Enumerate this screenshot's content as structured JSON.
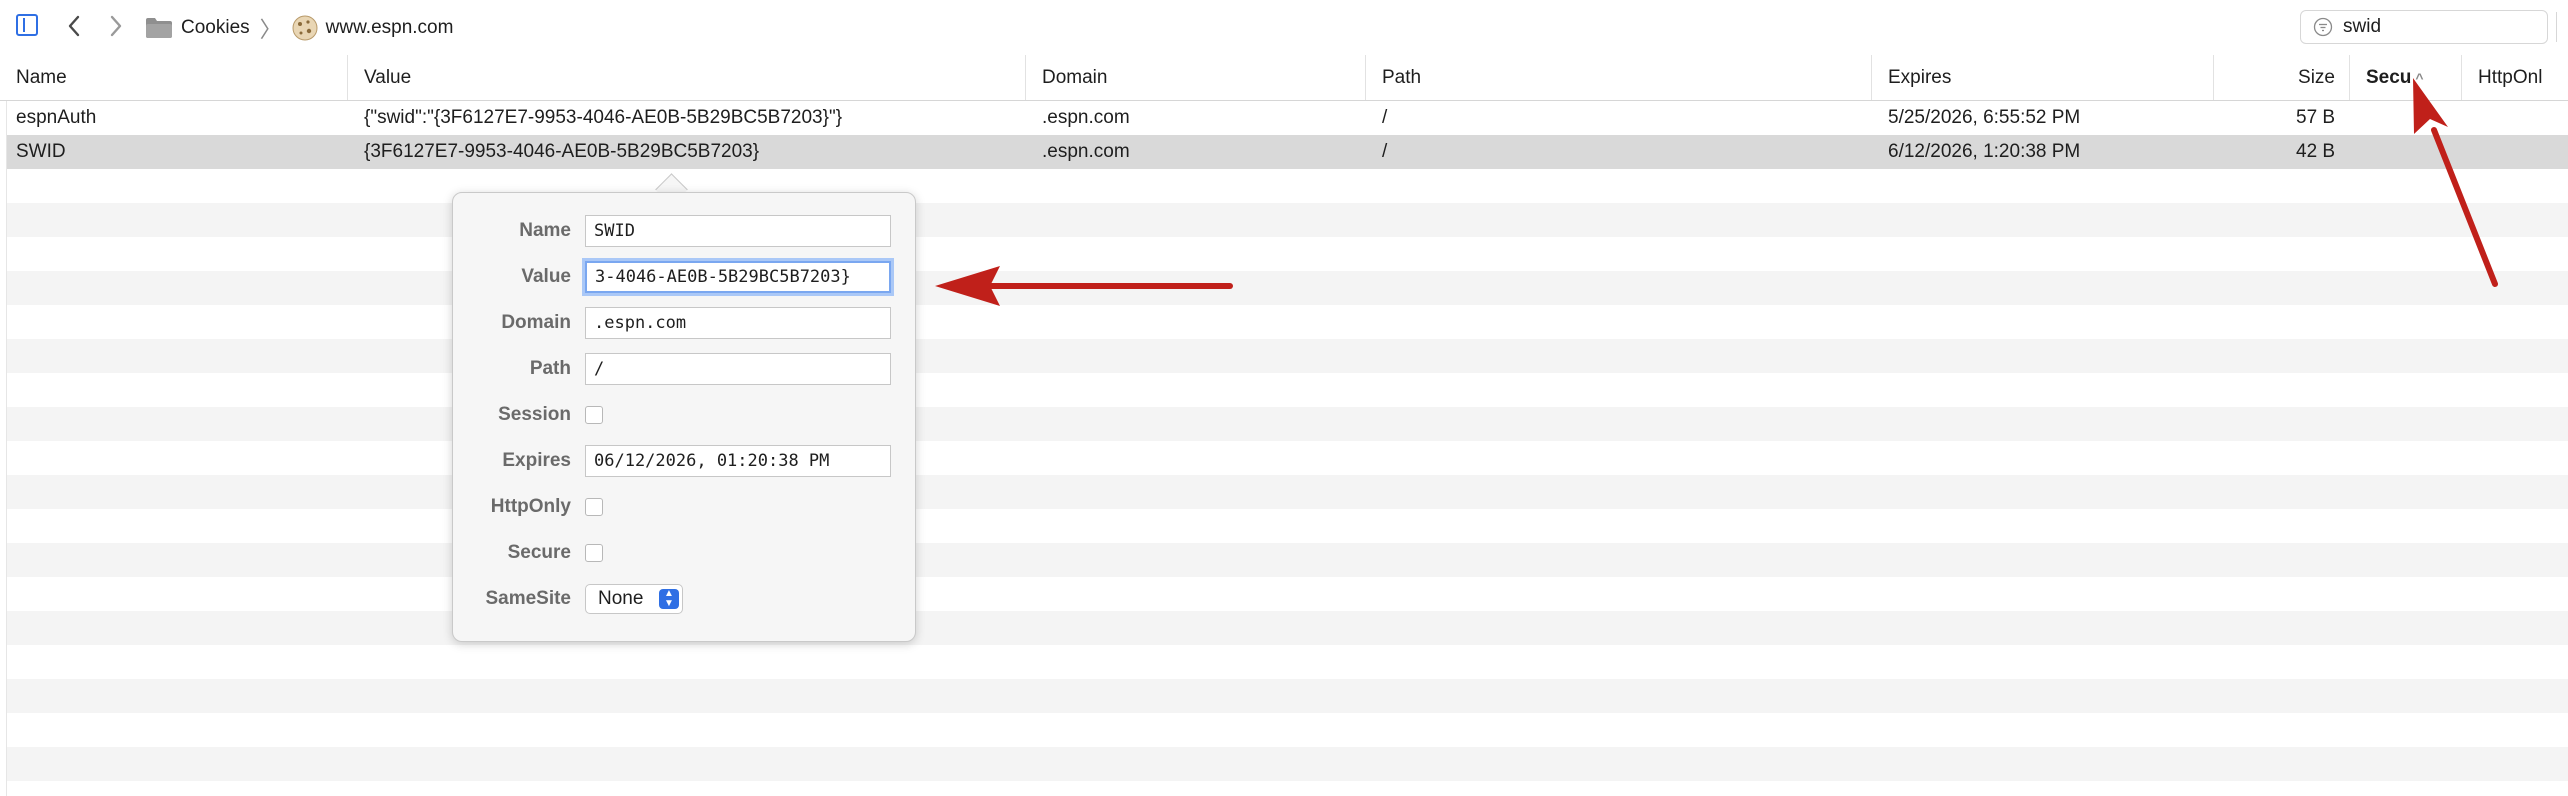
{
  "toolbar": {
    "breadcrumb": [
      "Cookies",
      "www.espn.com"
    ],
    "search_value": "swid"
  },
  "columns": [
    {
      "key": "name",
      "label": "Name"
    },
    {
      "key": "value",
      "label": "Value"
    },
    {
      "key": "domain",
      "label": "Domain"
    },
    {
      "key": "path",
      "label": "Path"
    },
    {
      "key": "expires",
      "label": "Expires"
    },
    {
      "key": "size",
      "label": "Size"
    },
    {
      "key": "secure",
      "label": "Secu"
    },
    {
      "key": "httponly",
      "label": "HttpOnl"
    }
  ],
  "rows": [
    {
      "name": "espnAuth",
      "value": "{\"swid\":\"{3F6127E7-9953-4046-AE0B-5B29BC5B7203}\"}",
      "domain": ".espn.com",
      "path": "/",
      "expires": "5/25/2026, 6:55:52 PM",
      "size": "57 B"
    },
    {
      "name": "SWID",
      "value": "{3F6127E7-9953-4046-AE0B-5B29BC5B7203}",
      "domain": ".espn.com",
      "path": "/",
      "expires": "6/12/2026, 1:20:38 PM",
      "size": "42 B"
    }
  ],
  "popover": {
    "labels": {
      "name": "Name",
      "value": "Value",
      "domain": "Domain",
      "path": "Path",
      "session": "Session",
      "expires": "Expires",
      "httponly": "HttpOnly",
      "secure": "Secure",
      "samesite": "SameSite"
    },
    "fields": {
      "name": "SWID",
      "value": "3-4046-AE0B-5B29BC5B7203}",
      "domain": ".espn.com",
      "path": "/",
      "expires": "06/12/2026, 01:20:38 PM",
      "samesite": "None"
    },
    "session": false,
    "httponly": false,
    "secure": false
  },
  "colors": {
    "accent": "#2f6fe4",
    "selected_row": "#d9d9d9",
    "annotation_arrow": "#c0201a"
  },
  "icons": [
    "sidebar-toggle-icon",
    "chevron-left-icon",
    "chevron-right-icon",
    "folder-icon",
    "globe-icon",
    "filter-icon"
  ]
}
